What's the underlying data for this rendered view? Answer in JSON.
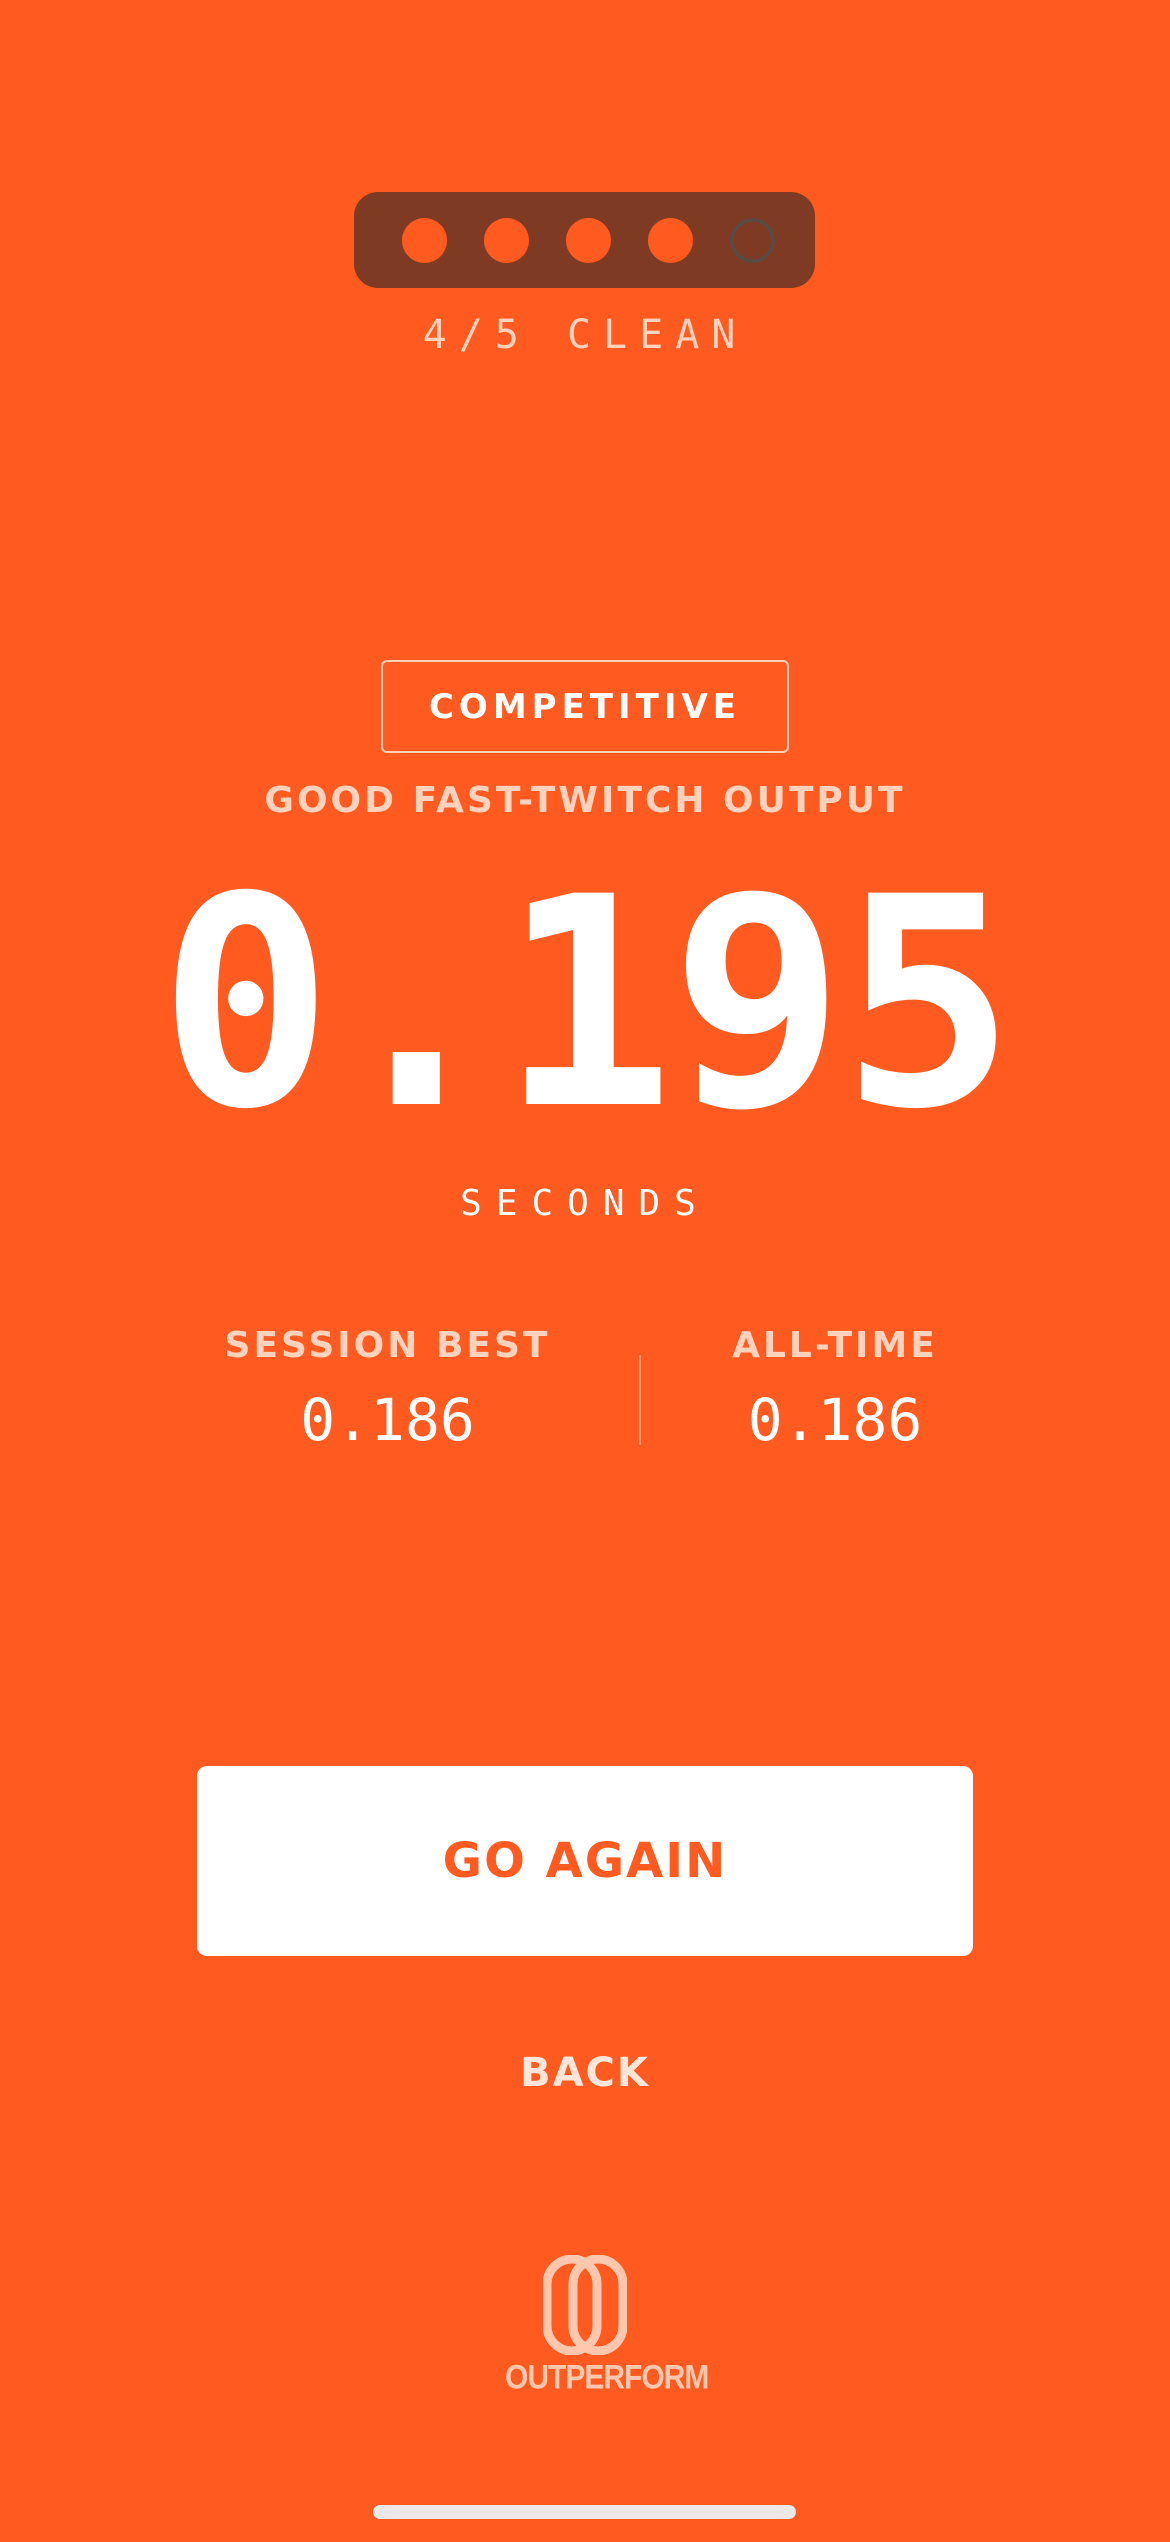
{
  "progress": {
    "dots": [
      {
        "state": "filled"
      },
      {
        "state": "filled"
      },
      {
        "state": "filled"
      },
      {
        "state": "filled"
      },
      {
        "state": "empty"
      }
    ],
    "completed": 4,
    "total": 5,
    "label": "4/5 CLEAN"
  },
  "result": {
    "badge": "COMPETITIVE",
    "subtitle": "GOOD FAST-TWITCH OUTPUT",
    "time": "0.195",
    "unit": "SECONDS"
  },
  "stats": {
    "session_best": {
      "label": "SESSION BEST",
      "value": "0.186"
    },
    "all_time": {
      "label": "ALL-TIME",
      "value": "0.186"
    }
  },
  "actions": {
    "go_again": "GO AGAIN",
    "back": "BACK"
  },
  "brand": {
    "logo_text": "OUTPERFORM",
    "logo_icon": "outperform-logo-icon"
  },
  "colors": {
    "background": "#FF5A1F",
    "pill": "#7E3A22",
    "button_bg": "#FFFFFF",
    "button_text": "#FF5A1F",
    "muted_text": "#FFD2BD"
  }
}
